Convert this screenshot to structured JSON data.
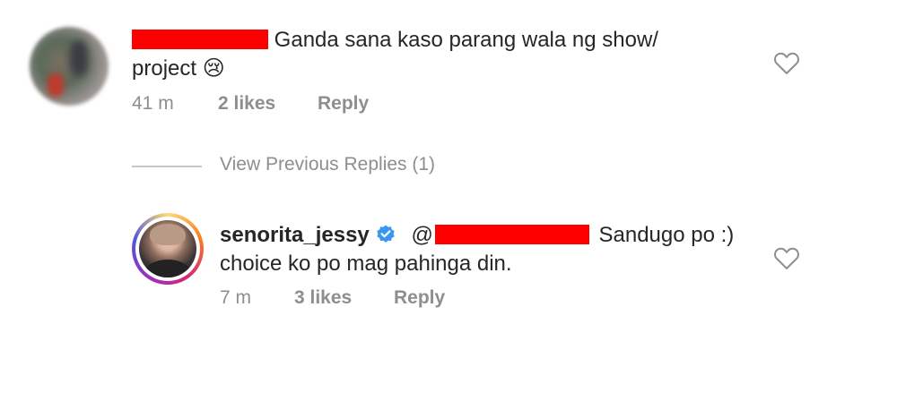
{
  "comment1": {
    "text": "Ganda sana kaso parang wala ng show/",
    "text_line2": "project",
    "emoji": "😢",
    "time": "41 m",
    "likes": "2 likes",
    "reply_label": "Reply"
  },
  "view_previous_replies": "View Previous Replies (1)",
  "reply1": {
    "username": "senorita_jessy",
    "mention_prefix": "@",
    "text": "Sandugo po :)",
    "text_line2": "choice ko po mag pahinga din.",
    "time": "7 m",
    "likes": "3 likes",
    "reply_label": "Reply"
  },
  "colors": {
    "redaction": "#ff0000",
    "verified_badge": "#3897f0",
    "secondary_text": "#8e8e8e"
  }
}
